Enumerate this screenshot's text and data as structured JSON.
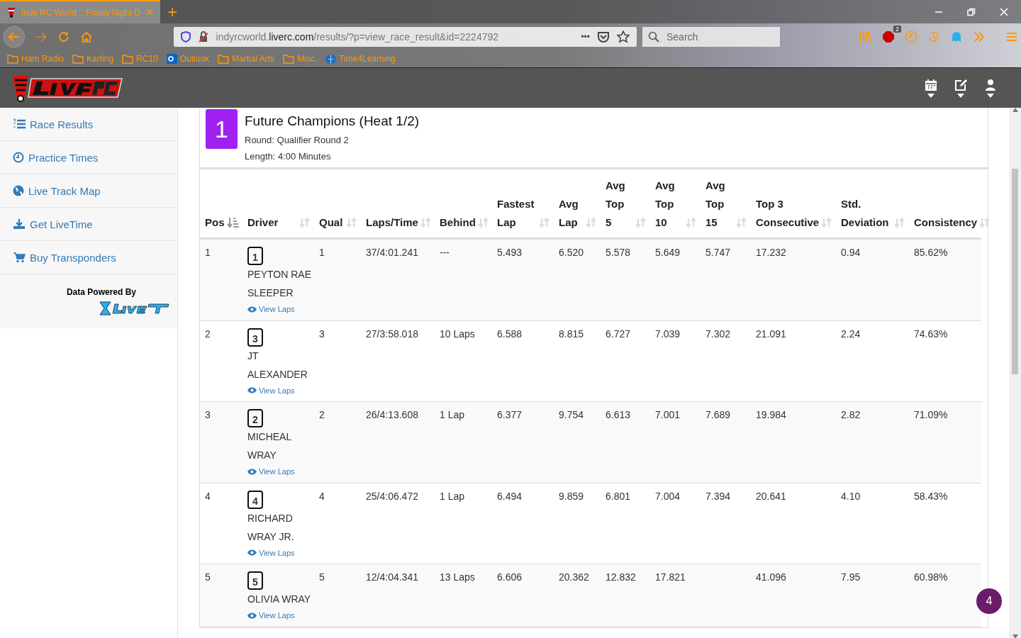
{
  "browser": {
    "tab": {
      "title": "Indy RC World :: Friday Night D",
      "close": "×"
    },
    "new_tab": "+",
    "url_host": "indyrcworld.",
    "url_domain": "liverc.com",
    "url_path": "/results/?p=view_race_result&id=2224792",
    "more": "•••",
    "search": {
      "placeholder": "Search"
    },
    "abp_badge": "2",
    "bookmarks": [
      {
        "kind": "folder",
        "label": "Ham Radio"
      },
      {
        "kind": "folder",
        "label": "Karting"
      },
      {
        "kind": "folder",
        "label": "RC10"
      },
      {
        "kind": "outlook",
        "label": "Outlook"
      },
      {
        "kind": "folder",
        "label": "Martial Arts"
      },
      {
        "kind": "folder",
        "label": "Misc."
      },
      {
        "kind": "globe",
        "label": "Time4Learning"
      }
    ]
  },
  "sidebar": {
    "items": [
      {
        "kind": "list",
        "label": "Race Results"
      },
      {
        "kind": "clock",
        "label": "Practice Times"
      },
      {
        "kind": "globe",
        "label": "Live Track Map"
      },
      {
        "kind": "download",
        "label": "Get LiveTime"
      },
      {
        "kind": "cart",
        "label": "Buy Transponders"
      }
    ],
    "powered_by": "Data Powered By"
  },
  "race": {
    "number": "1",
    "title": "Future Champions (Heat 1/2)",
    "round": "Round: Qualifier Round 2",
    "length": "Length: 4:00 Minutes"
  },
  "table": {
    "columns": [
      {
        "label": "Pos",
        "sorted": true
      },
      {
        "label": "Driver",
        "sorted": false
      },
      {
        "label": "Qual",
        "sorted": false
      },
      {
        "label": "Laps/Time",
        "sorted": false
      },
      {
        "label": "Behind",
        "sorted": false
      },
      {
        "label": "Fastest Lap",
        "sorted": false
      },
      {
        "label": "Avg Lap",
        "sorted": false
      },
      {
        "label": "Avg Top 5",
        "sorted": false
      },
      {
        "label": "Avg Top 10",
        "sorted": false
      },
      {
        "label": "Avg Top 15",
        "sorted": false
      },
      {
        "label": "Top 3 Consecutive",
        "sorted": false
      },
      {
        "label": "Std. Deviation",
        "sorted": false
      },
      {
        "label": "Consistency",
        "sorted": false
      }
    ],
    "rows": [
      {
        "cells": [
          "1",
          {
            "car": "1",
            "driver": "PEYTON RAE SLEEPER",
            "link": "View Laps"
          },
          "1",
          "37/4:01.241",
          "---",
          "5.493",
          "6.520",
          "5.578",
          "5.649",
          "5.747",
          "17.232",
          "0.94",
          "85.62%"
        ]
      },
      {
        "cells": [
          "2",
          {
            "car": "3",
            "driver": "JT ALEXANDER",
            "link": "View Laps"
          },
          "3",
          "27/3:58.018",
          "10 Laps",
          "6.588",
          "8.815",
          "6.727",
          "7.039",
          "7.302",
          "21.091",
          "2.24",
          "74.63%"
        ]
      },
      {
        "cells": [
          "3",
          {
            "car": "2",
            "driver": "MICHEAL WRAY",
            "link": "View Laps"
          },
          "2",
          "26/4:13.608",
          "1 Lap",
          "6.377",
          "9.754",
          "6.613",
          "7.001",
          "7.689",
          "19.984",
          "2.82",
          "71.09%"
        ]
      },
      {
        "cells": [
          "4",
          {
            "car": "4",
            "driver": "RICHARD WRAY JR.",
            "link": "View Laps"
          },
          "4",
          "25/4:06.472",
          "1 Lap",
          "6.494",
          "9.859",
          "6.801",
          "7.004",
          "7.394",
          "20.641",
          "4.10",
          "58.43%"
        ]
      },
      {
        "cells": [
          "5",
          {
            "car": "5",
            "driver": "OLIVIA WRAY",
            "link": "View Laps"
          },
          "5",
          "12/4:04.341",
          "13 Laps",
          "6.606",
          "20.362",
          "12.832",
          "17.821",
          "",
          "41.096",
          "7.95",
          "60.98%"
        ]
      }
    ]
  },
  "floating_badge": "4"
}
